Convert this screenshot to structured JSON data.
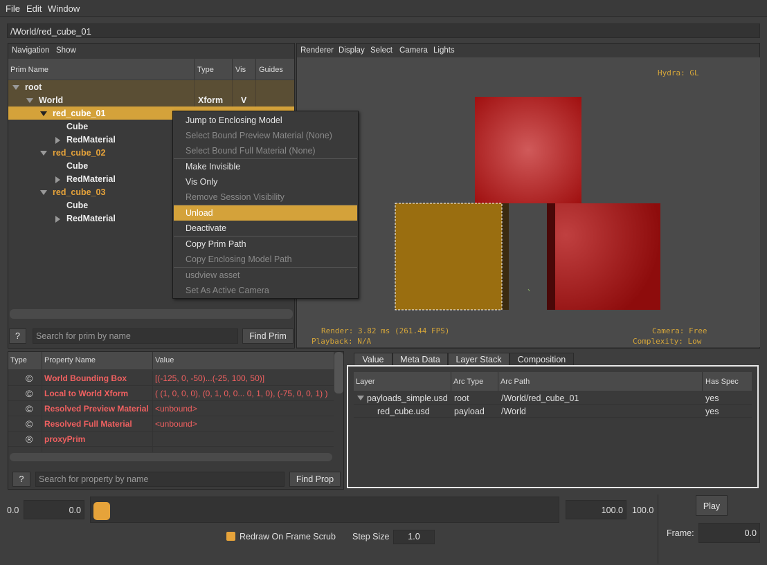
{
  "menubar": {
    "file": "File",
    "edit": "Edit",
    "window": "Window"
  },
  "path": "/World/red_cube_01",
  "nav": {
    "menu_navigation": "Navigation",
    "menu_show": "Show",
    "col_name": "Prim Name",
    "col_type": "Type",
    "col_vis": "Vis",
    "col_guides": "Guides",
    "rows": [
      {
        "name": "root",
        "type": "",
        "vis": ""
      },
      {
        "name": "World",
        "type": "Xform",
        "vis": "V"
      },
      {
        "name": "red_cube_01",
        "type": "",
        "vis": ""
      },
      {
        "name": "Cube",
        "type": "",
        "vis": ""
      },
      {
        "name": "RedMaterial",
        "type": "",
        "vis": ""
      },
      {
        "name": "red_cube_02",
        "type": "",
        "vis": ""
      },
      {
        "name": "Cube",
        "type": "",
        "vis": ""
      },
      {
        "name": "RedMaterial",
        "type": "",
        "vis": ""
      },
      {
        "name": "red_cube_03",
        "type": "",
        "vis": ""
      },
      {
        "name": "Cube",
        "type": "",
        "vis": ""
      },
      {
        "name": "RedMaterial",
        "type": "",
        "vis": ""
      }
    ],
    "help": "?",
    "search_placeholder": "Search for prim by name",
    "find_button": "Find Prim"
  },
  "context_menu": {
    "items": [
      {
        "label": "Jump to Enclosing Model",
        "enabled": true
      },
      {
        "label": "Select Bound Preview Material (None)",
        "enabled": false
      },
      {
        "label": "Select Bound Full Material (None)",
        "enabled": false
      },
      {
        "label": "Make Invisible",
        "enabled": true
      },
      {
        "label": "Vis Only",
        "enabled": true
      },
      {
        "label": "Remove Session Visibility",
        "enabled": false
      },
      {
        "label": "Unload",
        "enabled": true,
        "highlighted": true
      },
      {
        "label": "Deactivate",
        "enabled": true
      },
      {
        "label": "Copy Prim Path",
        "enabled": true
      },
      {
        "label": "Copy Enclosing Model  Path",
        "enabled": false
      },
      {
        "label": "usdview asset",
        "enabled": false
      },
      {
        "label": "Set As Active Camera",
        "enabled": false
      }
    ]
  },
  "viewport": {
    "menus": [
      "Renderer",
      "Display",
      "Select",
      "Camera",
      "Lights"
    ],
    "hydra": "Hydra: GL",
    "render_stats": "Render: 3.82 ms (261.44 FPS)",
    "playback": "Playback: N/A",
    "camera": "Camera: Free",
    "complexity": "Complexity: Low"
  },
  "properties": {
    "col_type": "Type",
    "col_name": "Property Name",
    "col_value": "Value",
    "rows": [
      {
        "type_icon": "©",
        "name": "World Bounding Box",
        "value": "[(-125, 0, -50)...(-25, 100, 50)]"
      },
      {
        "type_icon": "©",
        "name": "Local to World Xform",
        "value": "( (1, 0, 0, 0), (0, 1, 0, 0... 0, 1, 0), (-75, 0, 0, 1) )"
      },
      {
        "type_icon": "©",
        "name": "Resolved Preview Material",
        "value": "<unbound>"
      },
      {
        "type_icon": "©",
        "name": "Resolved Full Material",
        "value": "<unbound>"
      },
      {
        "type_icon": "®",
        "name": "proxyPrim",
        "value": ""
      }
    ],
    "help": "?",
    "search_placeholder": "Search for property by name",
    "find_button": "Find Prop"
  },
  "inspector": {
    "tabs": [
      "Value",
      "Meta Data",
      "Layer Stack",
      "Composition"
    ],
    "active_tab": "Composition",
    "col_layer": "Layer",
    "col_arc_type": "Arc Type",
    "col_arc_path": "Arc Path",
    "col_has_spec": "Has Spec",
    "rows": [
      {
        "layer": "payloads_simple.usd",
        "arc_type": "root",
        "arc_path": "/World/red_cube_01",
        "has_spec": "yes"
      },
      {
        "layer": "red_cube.usd",
        "arc_type": "payload",
        "arc_path": "/World",
        "has_spec": "yes"
      }
    ]
  },
  "timeline": {
    "start_label": "0.0",
    "start_value": "0.0",
    "end_value": "100.0",
    "end_label": "100.0",
    "play": "Play",
    "redraw_label": "Redraw On Frame Scrub",
    "step_label": "Step Size",
    "step_value": "1.0",
    "frame_label": "Frame:",
    "frame_value": "0.0"
  },
  "colors": {
    "accent": "#e6a33a",
    "selection": "#d4a23a",
    "cube_red": "#a01010"
  }
}
